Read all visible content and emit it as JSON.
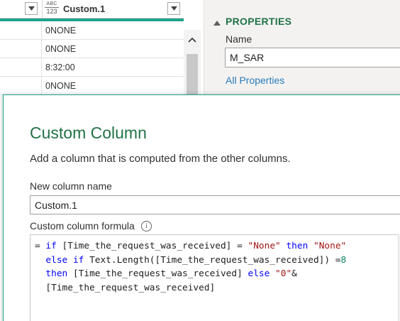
{
  "grid": {
    "column_type_icon": {
      "top": "ABC",
      "bottom": "123"
    },
    "column_name": "Custom.1",
    "rows": [
      "0NONE",
      "0NONE",
      "8:32:00",
      "0NONE"
    ],
    "accent_color": "#21a38a"
  },
  "properties": {
    "title": "PROPERTIES",
    "name_label": "Name",
    "name_value": "M_SAR",
    "all_properties_link": "All Properties",
    "title_color": "#217346",
    "link_color": "#2b7bb9"
  },
  "dialog": {
    "title": "Custom Column",
    "description": "Add a column that is computed from the other columns.",
    "new_column_name_label": "New column name",
    "new_column_name_value": "Custom.1",
    "formula_label": "Custom column formula",
    "formula_lines": [
      [
        {
          "t": "= ",
          "c": "op"
        },
        {
          "t": "if",
          "c": "kw"
        },
        {
          "t": " [Time_the_request_was_received] = ",
          "c": "ref"
        },
        {
          "t": "\"None\"",
          "c": "str"
        },
        {
          "t": " ",
          "c": "ref"
        },
        {
          "t": "then",
          "c": "kw"
        },
        {
          "t": " ",
          "c": "ref"
        },
        {
          "t": "\"None\"",
          "c": "str"
        }
      ],
      [
        {
          "t": "  ",
          "c": "ref"
        },
        {
          "t": "else if",
          "c": "kw"
        },
        {
          "t": " Text.Length([Time_the_request_was_received]) =",
          "c": "ref"
        },
        {
          "t": "8",
          "c": "num"
        }
      ],
      [
        {
          "t": "  ",
          "c": "ref"
        },
        {
          "t": "then",
          "c": "kw"
        },
        {
          "t": " [Time_the_request_was_received] ",
          "c": "ref"
        },
        {
          "t": "else",
          "c": "kw"
        },
        {
          "t": " ",
          "c": "ref"
        },
        {
          "t": "\"0\"",
          "c": "str"
        },
        {
          "t": "&",
          "c": "ref"
        }
      ],
      [
        {
          "t": "  [Time_the_request_was_received]",
          "c": "ref"
        }
      ]
    ]
  }
}
